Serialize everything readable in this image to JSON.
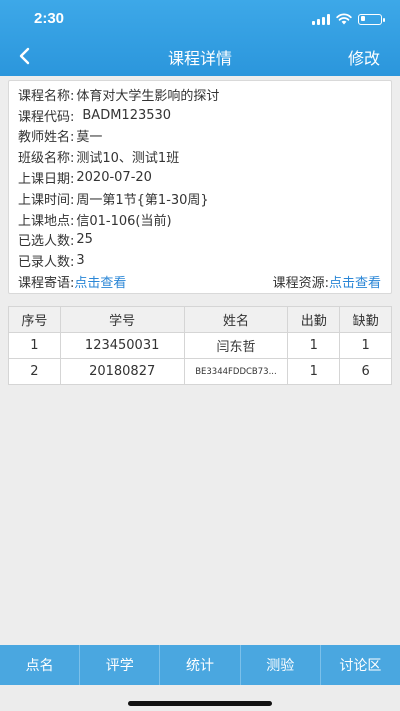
{
  "status": {
    "time": "2:30"
  },
  "nav": {
    "title": "课程详情",
    "edit": "修改"
  },
  "course": {
    "name_label": "课程名称:",
    "name": "体育对大学生影响的探讨",
    "code_label": "课程代码:",
    "code": "BADM123530",
    "teacher_label": "教师姓名:",
    "teacher": "莫一",
    "class_label": "班级名称:",
    "class": "测试10、测试1班",
    "date_label": "上课日期:",
    "date": "2020-07-20",
    "time_label": "上课时间:",
    "time": "周一第1节{第1-30周}",
    "place_label": "上课地点:",
    "place": "信01-106(当前)",
    "selected_label": "已选人数:",
    "selected": "25",
    "recorded_label": "已录人数:",
    "recorded": "3",
    "message_label": "课程寄语:",
    "message_link": "点击查看",
    "resource_label": "课程资源:",
    "resource_link": "点击查看"
  },
  "table": {
    "headers": [
      "序号",
      "学号",
      "姓名",
      "出勤",
      "缺勤"
    ],
    "rows": [
      [
        "1",
        "123450031",
        "闫东哲",
        "1",
        "1"
      ],
      [
        "2",
        "20180827",
        "BE3344FDDCB73...",
        "1",
        "6"
      ]
    ]
  },
  "bottom_nav": [
    "点名",
    "评学",
    "统计",
    "测验",
    "讨论区"
  ],
  "colors": {
    "header": "#2b96dc",
    "bottom_bar": "#4aa7e0",
    "link": "#2a86d6"
  }
}
